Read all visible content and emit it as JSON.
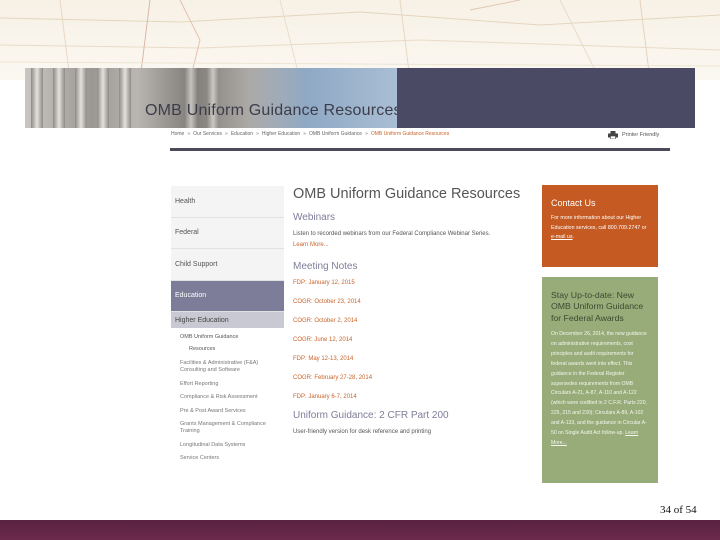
{
  "banner": {
    "title": "OMB Uniform Guidance Resources"
  },
  "breadcrumb": [
    "Home",
    "Our Services",
    "Education",
    "Higher Education",
    "OMB Uniform Guidance",
    "OMB Uniform Guidance Resources"
  ],
  "breadcrumb_separator": "»",
  "printer": {
    "label": "Printer Friendly",
    "icon": "printer-icon"
  },
  "sidebar": {
    "items": [
      "Health",
      "Federal",
      "Child Support",
      "Education"
    ],
    "sub": "Higher Education",
    "leaves": [
      "OMB Uniform Guidance",
      "Resources",
      "Facilities & Administrative (F&A) Consulting and Software",
      "Effort Reporting",
      "Compliance & Risk Assessment",
      "Pre & Post Award Services",
      "Grants Management & Compliance Training",
      "Longitudinal Data Systems",
      "Service Centers"
    ]
  },
  "main": {
    "title": "OMB Uniform Guidance Resources",
    "webinars": {
      "heading": "Webinars",
      "text": "Listen to recorded webinars from our Federal Compliance Webinar Series.",
      "link": "Learn More..."
    },
    "meeting_notes": {
      "heading": "Meeting Notes",
      "links": [
        "FDP: January 12, 2015",
        "COGR: October 23, 2014",
        "COGR: October 2, 2014",
        "COGR: June 12, 2014",
        "FDP: May 12-13, 2014",
        "COGR: February 27-28, 2014",
        "FDP: January 6-7, 2014"
      ]
    },
    "cfr": {
      "heading": "Uniform Guidance: 2 CFR Part 200",
      "text": "User-friendly version for desk reference and printing"
    }
  },
  "contact": {
    "heading": "Contact Us",
    "text": "For more information about our Higher Education services, call 800.709.2747 or",
    "link": "e-mail us",
    "end": "."
  },
  "update": {
    "heading": "Stay Up-to-date: New OMB Uniform Guidance for Federal Awards",
    "text": "On December 26, 2014, the new guidance on administrative requirements, cost principles and audit requirements for federal awards went into effect. This guidance in the Federal Register supersedes requirements from OMB Circulars A-21, A-87, A-110 and A-122 (which were codified in 2 C.F.R. Parts 220, 225, 215 and 230); Circulars A-89, A-102 and A-133, and the guidance in Circular A-50 on Single Audit Act follow-up.",
    "link": "Learn More..."
  },
  "slide": {
    "page_number": "34 of 54"
  },
  "colors": {
    "accent": "#c8642c",
    "nav_active": "#7d7d9a",
    "contact_bg": "#c55a22",
    "update_bg": "#97ac79",
    "banner_dark": "#4a4a65"
  }
}
